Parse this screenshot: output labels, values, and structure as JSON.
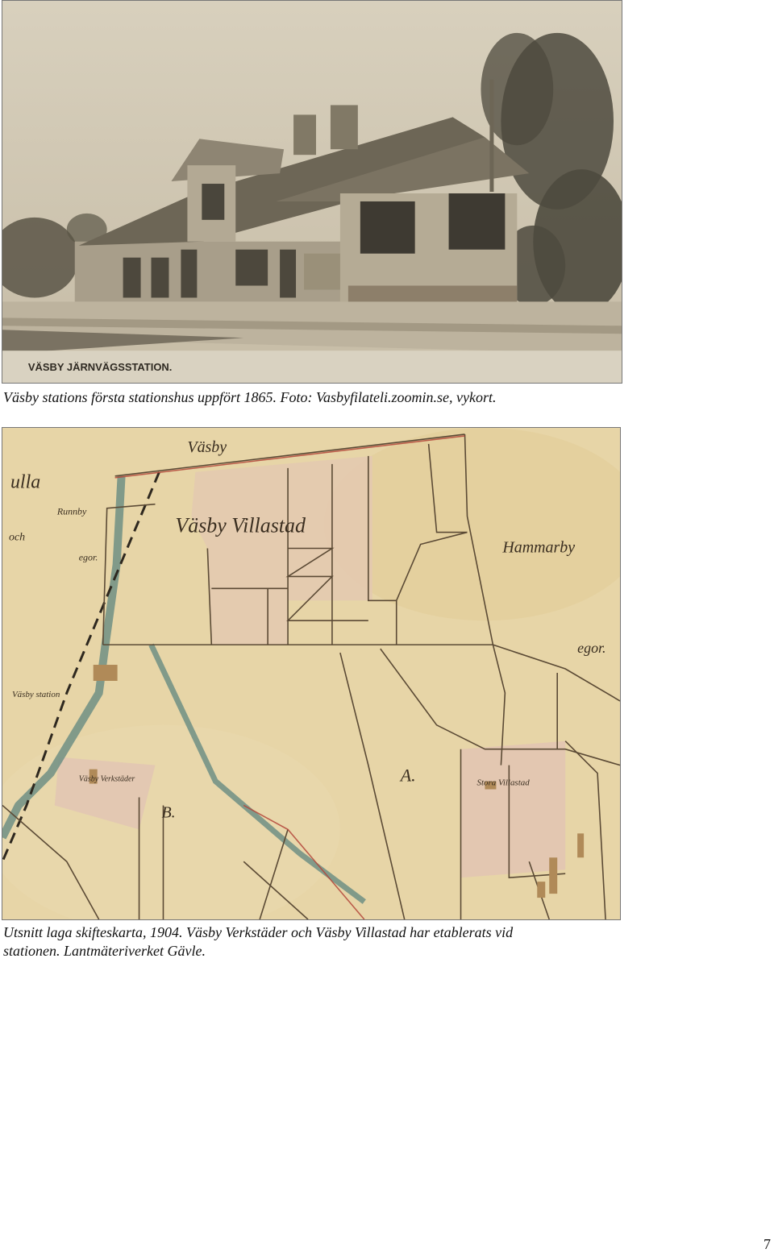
{
  "photo": {
    "printed_title": "VÄSBY JÄRNVÄGSSTATION.",
    "caption": "Väsby stations första stationshus uppfört 1865. Foto: Vasbyfilateli.zoomin.se, vykort."
  },
  "map": {
    "labels": {
      "vasby_top": "Väsby",
      "villastad": "Väsby Villastad",
      "hammarby": "Hammarby",
      "egor": "egor.",
      "runnby": "Runnby",
      "och": "och",
      "egor_small": "egor.",
      "station": "Väsby station",
      "verkstader": "Väsby Verkstäder",
      "stora_villastad": "Stora Villastad",
      "a_mark": "A.",
      "b_mark": "B.",
      "ulla": "ulla"
    },
    "caption_line1": "Utsnitt laga skifteskarta, 1904. Väsby Verkstäder och Väsby Villastad har etablerats vid",
    "caption_line2": "stationen. Lantmäteriverket Gävle."
  },
  "page": {
    "number": "7"
  },
  "colors": {
    "sepia_dark": "#3b352b",
    "sepia_mid": "#8a8070",
    "sepia_light": "#cfc6b3",
    "map_paper": "#e6d4a6",
    "map_lines": "#5b4a35",
    "map_water": "#6f8f84",
    "map_red": "#b3473a",
    "map_pink": "#e2c3b4"
  }
}
